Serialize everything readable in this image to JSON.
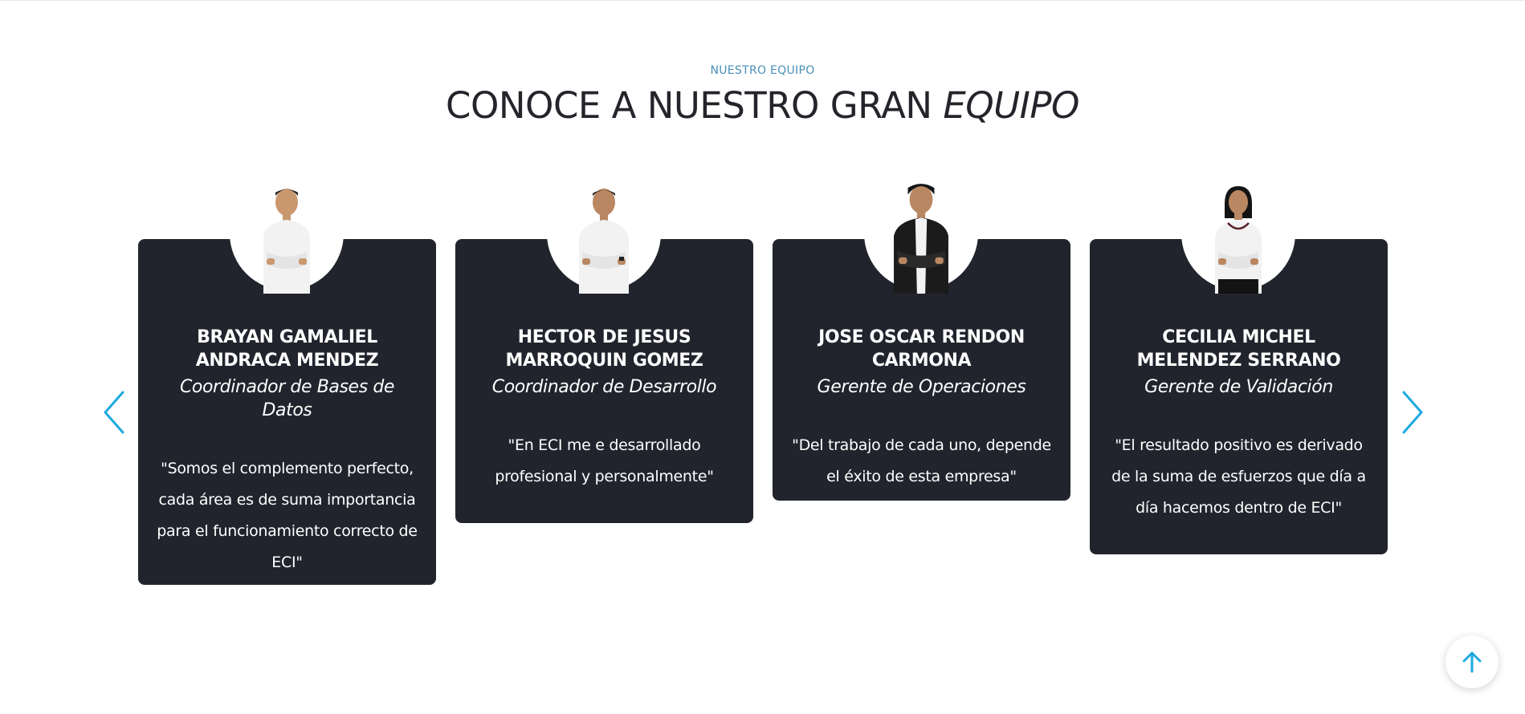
{
  "section": {
    "eyebrow": "NUESTRO EQUIPO",
    "title_main": "CONOCE A NUESTRO GRAN ",
    "title_emphasis": "EQUIPO"
  },
  "team": [
    {
      "name": "BRAYAN GAMALIEL ANDRACA MENDEZ",
      "role": "Coordinador de Bases de Datos",
      "quote": "\"Somos el complemento perfecto, cada área es de suma importancia para el funcionamiento correcto de ECI\"",
      "photo_icon": "man-white-shirt-arms-crossed"
    },
    {
      "name": "HECTOR DE JESUS MARROQUIN GOMEZ",
      "role": "Coordinador de Desarrollo",
      "quote": "\"En ECI me e desarrollado profesional y personalmente\"",
      "photo_icon": "man-white-shirt-arms-crossed"
    },
    {
      "name": "JOSE OSCAR RENDON CARMONA",
      "role": "Gerente de Operaciones",
      "quote": "\"Del trabajo de cada uno, depende el éxito de esta empresa\"",
      "photo_icon": "man-black-suit-arms-crossed"
    },
    {
      "name": "CECILIA MICHEL MELENDEZ SERRANO",
      "role": "Gerente de Validación",
      "quote": "\"El resultado positivo es derivado de la suma de esfuerzos que día a día hacemos dentro de ECI\"",
      "photo_icon": "woman-white-blouse-arms-crossed"
    }
  ],
  "controls": {
    "prev_icon": "chevron-left-icon",
    "next_icon": "chevron-right-icon",
    "scroll_top_icon": "arrow-up-icon"
  },
  "colors": {
    "card_bg": "#22242d",
    "accent": "#1ba9e1",
    "eyebrow": "#4a8fb7",
    "heading": "#23252b"
  }
}
